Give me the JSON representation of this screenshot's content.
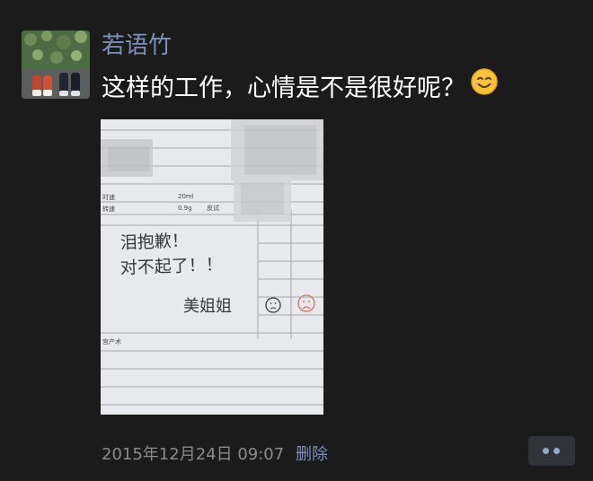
{
  "post": {
    "username": "若语竹",
    "text": "这样的工作，心情是不是很好呢？",
    "emoji": "smiling-face-emoji",
    "photo": {
      "form_labels": [
        "时速",
        "转速",
        "宫产术"
      ],
      "form_values": [
        "20ml",
        "0.9g",
        "皮试"
      ],
      "handwriting_line1": "泪抱歉！",
      "handwriting_line2": "对不起了！！",
      "signature": "美姐姐"
    },
    "timestamp": "2015年12月24日 09:07",
    "delete_label": "删除",
    "comment_icon": "two-dots-comment-icon"
  },
  "colors": {
    "background": "#1b1b1b",
    "username": "#7d90b8",
    "link": "#7d90b8",
    "timestamp": "#8b8b8b",
    "comment_button_bg": "#2f333a",
    "comment_dots": "#93abcb"
  }
}
